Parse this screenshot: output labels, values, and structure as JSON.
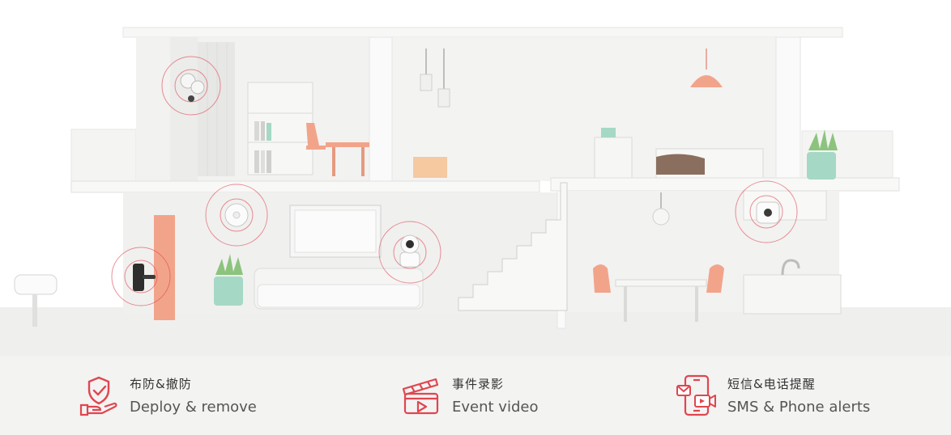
{
  "colors": {
    "accent": "#e0464f",
    "salmon": "#f2a48a",
    "mint": "#a6d8c6",
    "wall": "#f4f4f3",
    "floor": "#e9e9e8"
  },
  "scene_devices": [
    {
      "name": "floodlight-camera-icon"
    },
    {
      "name": "smoke-detector-icon"
    },
    {
      "name": "smart-lock-icon"
    },
    {
      "name": "pan-tilt-camera-icon"
    },
    {
      "name": "wall-camera-icon"
    }
  ],
  "features": [
    {
      "icon": "shield-hand-icon",
      "cn": "布防&撤防",
      "en": "Deploy & remove"
    },
    {
      "icon": "clapperboard-icon",
      "cn": "事件录影",
      "en": "Event video"
    },
    {
      "icon": "phone-alert-icon",
      "cn": "短信&电话提醒",
      "en": "SMS & Phone alerts"
    }
  ]
}
